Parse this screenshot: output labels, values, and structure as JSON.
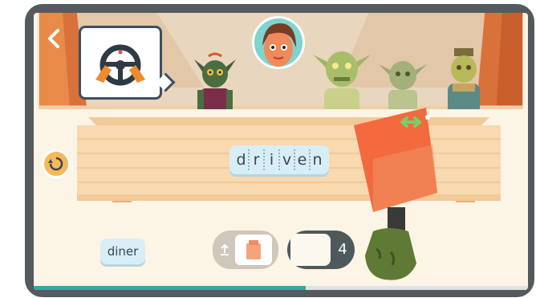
{
  "navigation": {
    "back_icon": "chevron-left-icon"
  },
  "prompt": {
    "icon": "steering-wheel-icon"
  },
  "word_board": {
    "letters": [
      "d",
      "r",
      "i",
      "v",
      "e",
      "n"
    ]
  },
  "controls": {
    "reset_icon": "reset-icon"
  },
  "tray": {
    "word_chip": "diner",
    "draw_pile_icon": "paper-bag-icon",
    "remaining_count": "4"
  },
  "tool": {
    "handle_icon": "double-arrow-icon"
  },
  "progress": {
    "fraction": 0.55
  },
  "colors": {
    "accent": "#3aa6a3",
    "cleaver": "#f26a3d",
    "board": "#f6d6ad",
    "tile": "#d8eef6"
  }
}
